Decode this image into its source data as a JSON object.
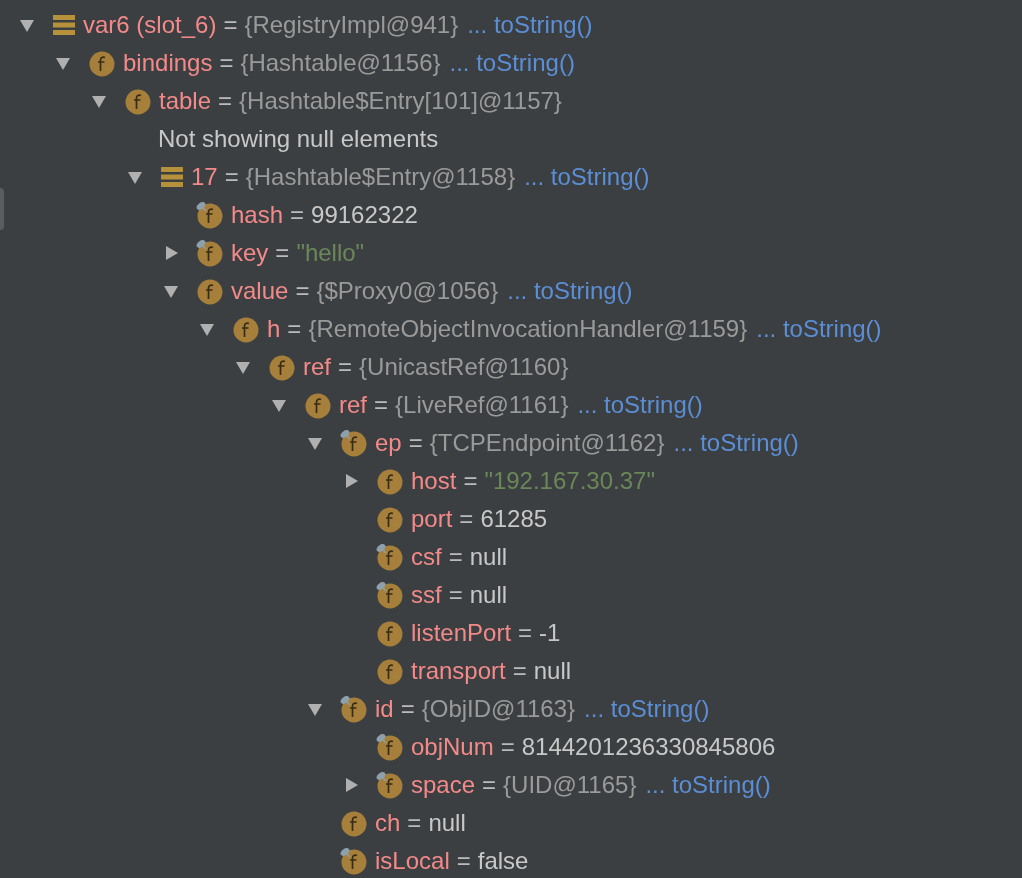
{
  "tree": [
    {
      "kind": "array",
      "name": "var6 (slot_6)",
      "sep": "=",
      "value": {
        "text": "{RegistryImpl@941}",
        "kind": "object"
      },
      "to_string": "... toString()",
      "expanded": true,
      "children": [
        {
          "kind": "field",
          "name": "bindings",
          "sep": "=",
          "value": {
            "text": "{Hashtable@1156}",
            "kind": "object"
          },
          "to_string": "... toString()",
          "expanded": true,
          "transient": false,
          "children": [
            {
              "kind": "field",
              "name": "table",
              "sep": "=",
              "value": {
                "text": "{Hashtable$Entry[101]@1157}",
                "kind": "object"
              },
              "expanded": true,
              "transient": false,
              "children": [
                {
                  "kind": "message",
                  "text": "Not showing null elements"
                },
                {
                  "kind": "array",
                  "name": "17",
                  "sep": "=",
                  "value": {
                    "text": "{Hashtable$Entry@1158}",
                    "kind": "object"
                  },
                  "to_string": "... toString()",
                  "expanded": true,
                  "children": [
                    {
                      "kind": "field",
                      "name": "hash",
                      "sep": "=",
                      "value": {
                        "text": "99162322",
                        "kind": "plain"
                      },
                      "transient": true
                    },
                    {
                      "kind": "field",
                      "name": "key",
                      "sep": "=",
                      "value": {
                        "text": "\"hello\"",
                        "kind": "string"
                      },
                      "expanded": false,
                      "transient": true
                    },
                    {
                      "kind": "field",
                      "name": "value",
                      "sep": "=",
                      "value": {
                        "text": "{$Proxy0@1056}",
                        "kind": "object"
                      },
                      "to_string": "... toString()",
                      "expanded": true,
                      "transient": false,
                      "children": [
                        {
                          "kind": "field",
                          "name": "h",
                          "sep": "=",
                          "value": {
                            "text": "{RemoteObjectInvocationHandler@1159}",
                            "kind": "object"
                          },
                          "to_string": "... toString()",
                          "expanded": true,
                          "transient": false,
                          "children": [
                            {
                              "kind": "field",
                              "name": "ref",
                              "sep": "=",
                              "value": {
                                "text": "{UnicastRef@1160}",
                                "kind": "object"
                              },
                              "expanded": true,
                              "transient": false,
                              "children": [
                                {
                                  "kind": "field",
                                  "name": "ref",
                                  "sep": "=",
                                  "value": {
                                    "text": "{LiveRef@1161}",
                                    "kind": "object"
                                  },
                                  "to_string": "... toString()",
                                  "expanded": true,
                                  "transient": false,
                                  "children": [
                                    {
                                      "kind": "field",
                                      "name": "ep",
                                      "sep": "=",
                                      "value": {
                                        "text": "{TCPEndpoint@1162}",
                                        "kind": "object"
                                      },
                                      "to_string": "... toString()",
                                      "expanded": true,
                                      "transient": true,
                                      "children": [
                                        {
                                          "kind": "field",
                                          "name": "host",
                                          "sep": "=",
                                          "value": {
                                            "text": "\"192.167.30.37\"",
                                            "kind": "string"
                                          },
                                          "expanded": false,
                                          "transient": false
                                        },
                                        {
                                          "kind": "field",
                                          "name": "port",
                                          "sep": "=",
                                          "value": {
                                            "text": "61285",
                                            "kind": "plain"
                                          },
                                          "transient": false
                                        },
                                        {
                                          "kind": "field",
                                          "name": "csf",
                                          "sep": "=",
                                          "value": {
                                            "text": "null",
                                            "kind": "plain"
                                          },
                                          "transient": true
                                        },
                                        {
                                          "kind": "field",
                                          "name": "ssf",
                                          "sep": "=",
                                          "value": {
                                            "text": "null",
                                            "kind": "plain"
                                          },
                                          "transient": true
                                        },
                                        {
                                          "kind": "field",
                                          "name": "listenPort",
                                          "sep": "=",
                                          "value": {
                                            "text": "-1",
                                            "kind": "plain"
                                          },
                                          "transient": false
                                        },
                                        {
                                          "kind": "field",
                                          "name": "transport",
                                          "sep": "=",
                                          "value": {
                                            "text": "null",
                                            "kind": "plain"
                                          },
                                          "transient": false
                                        }
                                      ]
                                    },
                                    {
                                      "kind": "field",
                                      "name": "id",
                                      "sep": "=",
                                      "value": {
                                        "text": "{ObjID@1163}",
                                        "kind": "object"
                                      },
                                      "to_string": "... toString()",
                                      "expanded": true,
                                      "transient": true,
                                      "children": [
                                        {
                                          "kind": "field",
                                          "name": "objNum",
                                          "sep": "=",
                                          "value": {
                                            "text": "8144201236330845806",
                                            "kind": "plain"
                                          },
                                          "transient": true
                                        },
                                        {
                                          "kind": "field",
                                          "name": "space",
                                          "sep": "=",
                                          "value": {
                                            "text": "{UID@1165}",
                                            "kind": "object"
                                          },
                                          "to_string": "... toString()",
                                          "expanded": false,
                                          "transient": true
                                        }
                                      ]
                                    },
                                    {
                                      "kind": "field",
                                      "name": "ch",
                                      "sep": "=",
                                      "value": {
                                        "text": "null",
                                        "kind": "plain"
                                      },
                                      "transient": false
                                    },
                                    {
                                      "kind": "field",
                                      "name": "isLocal",
                                      "sep": "=",
                                      "value": {
                                        "text": "false",
                                        "kind": "plain"
                                      },
                                      "transient": true
                                    }
                                  ]
                                }
                              ]
                            }
                          ]
                        }
                      ]
                    }
                  ]
                }
              ]
            }
          ]
        }
      ]
    }
  ]
}
